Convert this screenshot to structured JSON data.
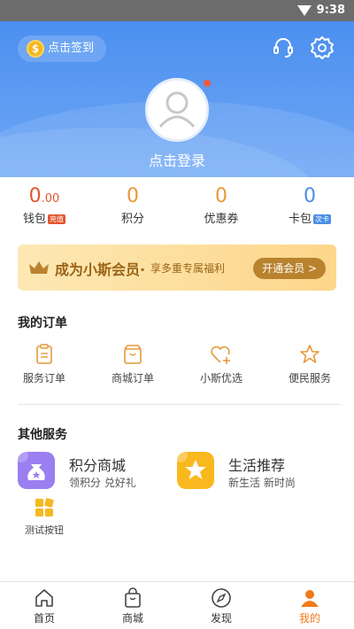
{
  "status_bar": {
    "time": "9:38"
  },
  "header": {
    "checkin_label": "点击签到",
    "coin_symbol": "$",
    "login_label": "点击登录"
  },
  "stats": [
    {
      "value_main": "0",
      "value_decimal": ".00",
      "label": "钱包",
      "tag": "充值",
      "tag_color": "#e2562e"
    },
    {
      "value_main": "0",
      "label": "积分"
    },
    {
      "value_main": "0",
      "label": "优惠券"
    },
    {
      "value_main": "0",
      "label": "卡包",
      "tag": "次卡",
      "tag_color": "#4a8ee6"
    }
  ],
  "vip": {
    "title": "成为小斯会员·",
    "subtitle": "享多重专属福利",
    "button": "开通会员 >"
  },
  "orders": {
    "title": "我的订单",
    "items": [
      {
        "label": "服务订单",
        "icon": "service-order-icon"
      },
      {
        "label": "商城订单",
        "icon": "mall-order-icon"
      },
      {
        "label": "小斯优选",
        "icon": "heart-plus-icon"
      },
      {
        "label": "便民服务",
        "icon": "star-outline-icon"
      }
    ]
  },
  "services": {
    "title": "其他服务",
    "items": [
      {
        "name": "积分商城",
        "desc": "领积分 兑好礼",
        "icon": "money-bag-icon",
        "color": "#9b7ef0"
      },
      {
        "name": "生活推荐",
        "desc": "新生活 新时尚",
        "icon": "star-badge-icon",
        "color": "#f9b81e"
      }
    ],
    "test_button": "测试按钮"
  },
  "tabbar": [
    {
      "label": "首页",
      "icon": "home-icon"
    },
    {
      "label": "商城",
      "icon": "shopping-bag-icon"
    },
    {
      "label": "发现",
      "icon": "compass-icon"
    },
    {
      "label": "我的",
      "icon": "person-icon",
      "active": true
    }
  ],
  "colors": {
    "header_blue": "#4b8fef",
    "accent_orange": "#f07a1a",
    "gold": "#b9832e"
  }
}
